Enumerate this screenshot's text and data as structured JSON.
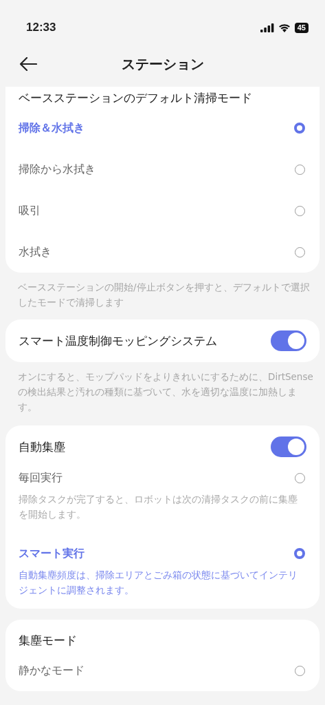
{
  "status_bar": {
    "time": "12:33",
    "battery": "45"
  },
  "header": {
    "title": "ステーション"
  },
  "sections": [
    {
      "kind": "radio",
      "heading": "ベースステーションのデフォルト清掃モード",
      "note": "ベースステーションの開始/停止ボタンを押すと、デフォルトで選択したモードで清掃します",
      "options": [
        {
          "label": "掃除＆水拭き",
          "selected": true
        },
        {
          "label": "掃除から水拭き",
          "selected": false
        },
        {
          "label": "吸引",
          "selected": false
        },
        {
          "label": "水拭き",
          "selected": false
        }
      ]
    },
    {
      "kind": "toggle",
      "heading": "スマート温度制御モッピングシステム",
      "on": true,
      "note": "オンにすると、モップパッドをよりきれいにするために、DirtSenseの検出結果と汚れの種類に基づいて、水を適切な温度に加熱します。"
    },
    {
      "kind": "toggle",
      "heading": "自動集塵",
      "on": true,
      "options": [
        {
          "label": "毎回実行",
          "selected": false,
          "description": "掃除タスクが完了すると、ロボットは次の清掃タスクの前に集塵を開始します。"
        },
        {
          "label": "スマート実行",
          "selected": true,
          "description": "自動集塵頻度は、掃除エリアとごみ箱の状態に基づいてインテリジェントに調整されます。"
        }
      ]
    },
    {
      "kind": "radio",
      "heading": "集塵モード",
      "options": [
        {
          "label": "静かなモード",
          "selected": false
        }
      ]
    }
  ]
}
